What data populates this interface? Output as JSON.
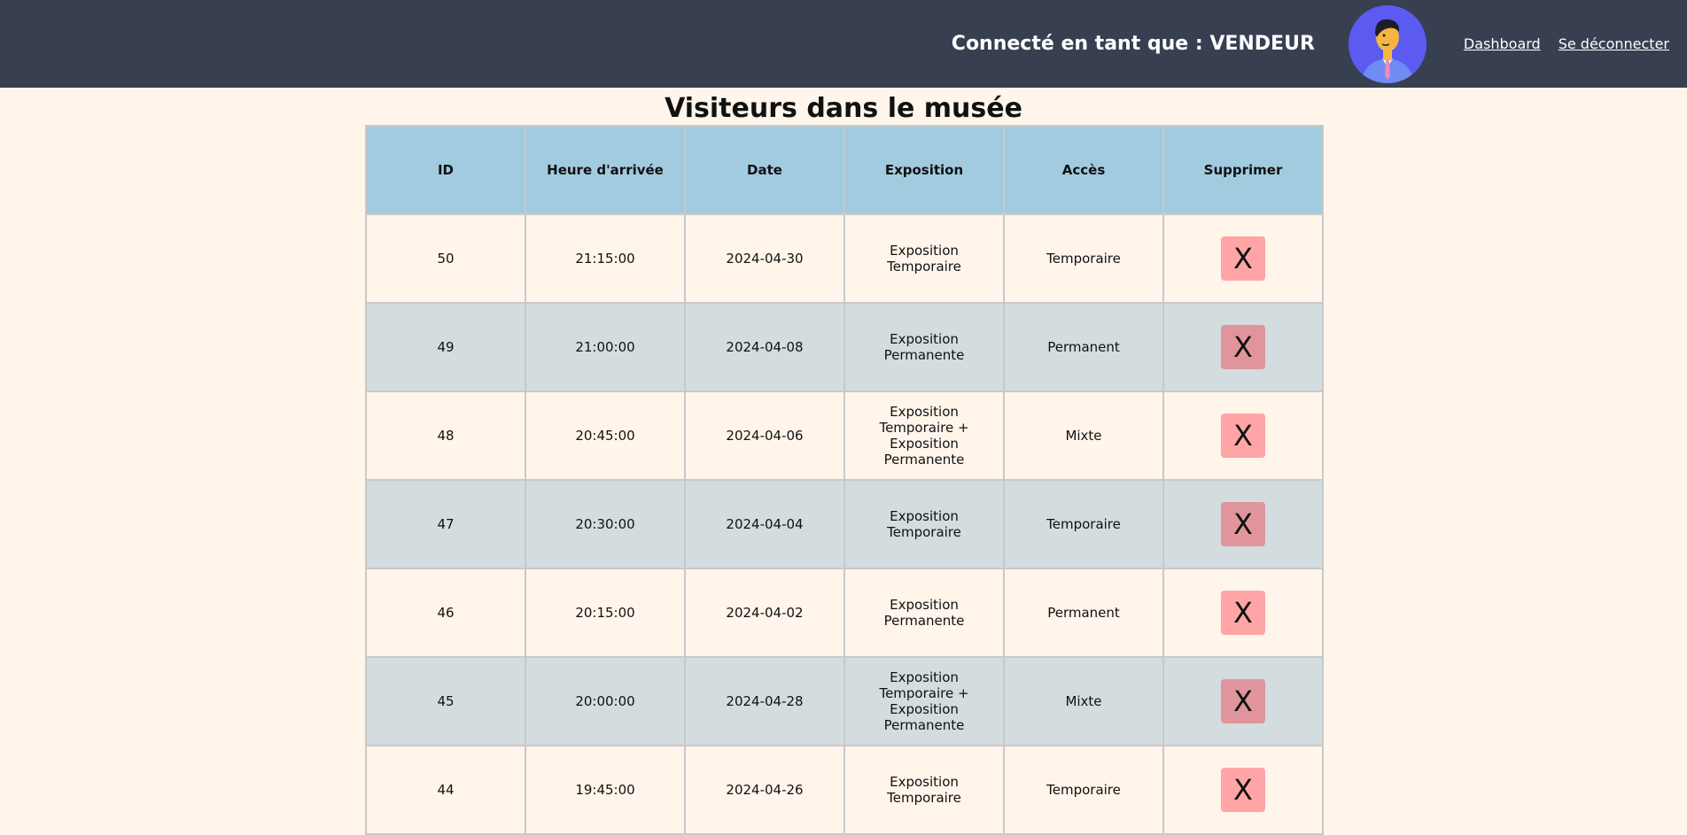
{
  "header": {
    "user_label": "Connecté en tant que : VENDEUR",
    "nav": [
      "Dashboard",
      "Se déconnecter"
    ]
  },
  "main": {
    "title": "Visiteurs dans le musée",
    "columns": [
      "ID",
      "Heure d'arrivée",
      "Date",
      "Exposition",
      "Accès",
      "Supprimer"
    ],
    "delete_label": "X",
    "rows": [
      {
        "id": "50",
        "time": "21:15:00",
        "date": "2024-04-30",
        "exposition": "Exposition Temporaire",
        "access": "Temporaire"
      },
      {
        "id": "49",
        "time": "21:00:00",
        "date": "2024-04-08",
        "exposition": "Exposition Permanente",
        "access": "Permanent"
      },
      {
        "id": "48",
        "time": "20:45:00",
        "date": "2024-04-06",
        "exposition": "Exposition Temporaire + Exposition Permanente",
        "access": "Mixte"
      },
      {
        "id": "47",
        "time": "20:30:00",
        "date": "2024-04-04",
        "exposition": "Exposition Temporaire",
        "access": "Temporaire"
      },
      {
        "id": "46",
        "time": "20:15:00",
        "date": "2024-04-02",
        "exposition": "Exposition Permanente",
        "access": "Permanent"
      },
      {
        "id": "45",
        "time": "20:00:00",
        "date": "2024-04-28",
        "exposition": "Exposition Temporaire + Exposition Permanente",
        "access": "Mixte"
      },
      {
        "id": "44",
        "time": "19:45:00",
        "date": "2024-04-26",
        "exposition": "Exposition Temporaire",
        "access": "Temporaire"
      }
    ]
  }
}
